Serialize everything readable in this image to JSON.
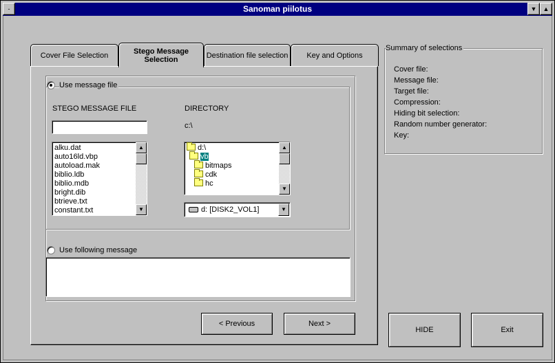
{
  "window": {
    "title": "Sanoman piilotus",
    "sys_menu": "-",
    "minimize": "▼",
    "maximize": "▲"
  },
  "tabs": [
    {
      "label": "Cover File Selection"
    },
    {
      "label": "Stego Message Selection",
      "line1": "Stego Message",
      "line2": "Selection"
    },
    {
      "label": "Destination file selection"
    },
    {
      "label": "Key and Options"
    }
  ],
  "stego": {
    "use_file_label": "Use message file",
    "file_header": "STEGO MESSAGE FILE",
    "dir_header": "DIRECTORY",
    "file_input_value": "",
    "current_dir": "c:\\",
    "files": [
      "alku.dat",
      "auto16ld.vbp",
      "autoload.mak",
      "biblio.ldb",
      "biblio.mdb",
      "bright.dib",
      "btrieve.txt",
      "constant.txt"
    ],
    "dirs": [
      {
        "name": "d:\\",
        "type": "open"
      },
      {
        "name": "vb",
        "type": "open",
        "selected": true
      },
      {
        "name": "bitmaps",
        "type": "closed"
      },
      {
        "name": "cdk",
        "type": "closed"
      },
      {
        "name": "hc",
        "type": "closed"
      }
    ],
    "drive_value": "d: [DISK2_VOL1]",
    "use_message_label": "Use following message",
    "message_text": ""
  },
  "buttons": {
    "previous": "< Previous",
    "next": "Next >",
    "hide": "HIDE",
    "exit": "Exit"
  },
  "summary": {
    "title": "Summary of selections",
    "lines": [
      "Cover file:",
      "Message file:",
      "Target file:",
      "Compression:",
      "Hiding bit selection:",
      "Random number generator:",
      "Key:"
    ]
  },
  "icons": {
    "scroll_up": "▲",
    "scroll_down": "▼",
    "dropdown": "▼"
  }
}
